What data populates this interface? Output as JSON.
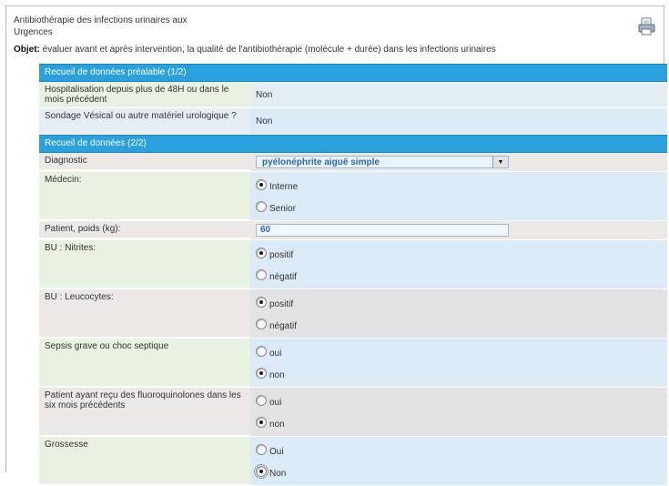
{
  "header": {
    "title_line1": "Antibiothérapie des infections urinaires aux",
    "title_line2": "Urgences",
    "objective_label": "Objet:",
    "objective_text": " évaluer avant et après intervention, la qualité de l'antibiothérapie (molécule + durée) dans les infections urinaires"
  },
  "sections": {
    "prealable": "Recueil de données préalable (1/2)",
    "donnees": "Recueil de données (2/2)"
  },
  "prealable": {
    "hospitalisation_label": "Hospitalisation depuis plus de 48H ou dans le mois précédent",
    "hospitalisation_value": "Non",
    "sondage_label": "Sondage Vésical ou autre matériel urologique ?",
    "sondage_value": "Non"
  },
  "donnees": {
    "diagnostic_label": "Diagnostic",
    "diagnostic_value": "pyélonéphrite aiguë simple",
    "medecin_label": "Médecin:",
    "medecin_opt1": "Interne",
    "medecin_opt2": "Senior",
    "poids_label": "Patient, poids (kg):",
    "poids_value": "60",
    "nitrites_label": "BU : Nitrites:",
    "nitrites_opt1": "positif",
    "nitrites_opt2": "négatif",
    "leucocytes_label": "BU : Leucocytes:",
    "leucocytes_opt1": "positif",
    "leucocytes_opt2": "négatif",
    "sepsis_label": "Sepsis grave ou choc septique",
    "sepsis_opt1": "oui",
    "sepsis_opt2": "non",
    "fluoro_label": "Patient ayant reçu des fluoroquinolones dans les six mois précédents",
    "fluoro_opt1": "oui",
    "fluoro_opt2": "non",
    "grossesse_label": "Grossesse",
    "grossesse_opt1": "Oui",
    "grossesse_opt2": "Non"
  },
  "icons": {
    "print": "print-icon",
    "dropdown": "chevron-down-icon"
  },
  "colors": {
    "section_bar": "#2aa1dc",
    "value_bg": "#dbeaf7",
    "selected_text": "#2e6aa9"
  }
}
